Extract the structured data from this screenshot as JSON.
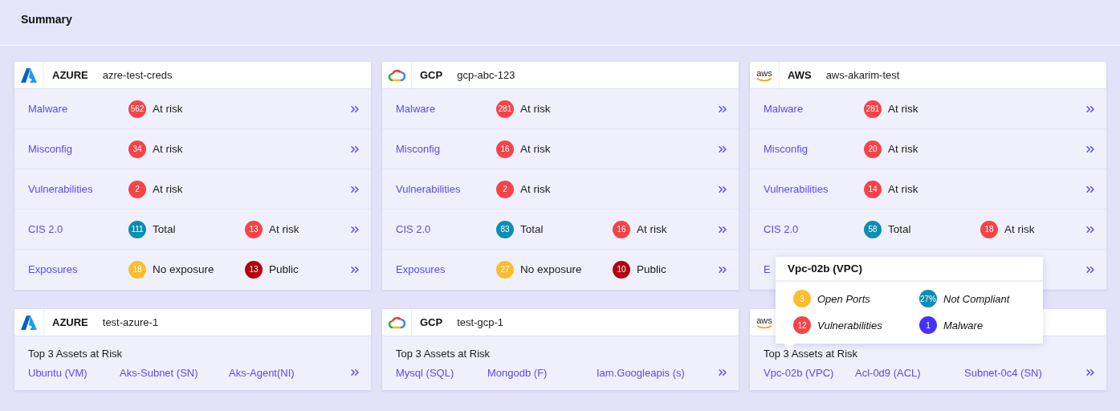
{
  "header": {
    "title": "Summary"
  },
  "accounts": [
    {
      "logo": {
        "kind": "azure"
      },
      "provider": "AZURE",
      "account": "azre-test-creds",
      "rows": [
        {
          "label": "Malware",
          "metrics": [
            {
              "count": "562",
              "label": "At risk",
              "color": "#f54448"
            }
          ]
        },
        {
          "label": "Misconfig",
          "metrics": [
            {
              "count": "34",
              "label": "At risk",
              "color": "#f54448"
            }
          ]
        },
        {
          "label": "Vulnerabilities",
          "metrics": [
            {
              "count": "2",
              "label": "At risk",
              "color": "#f54448"
            }
          ]
        },
        {
          "label": "CIS 2.0",
          "metrics": [
            {
              "count": "111",
              "label": "Total",
              "color": "#0c8db3"
            },
            {
              "count": "13",
              "label": "At risk",
              "color": "#f54448"
            }
          ]
        },
        {
          "label": "Exposures",
          "metrics": [
            {
              "count": "18",
              "label": "No exposure",
              "color": "#fbbd2e"
            },
            {
              "count": "13",
              "label": "Public",
              "color": "#b3000f"
            }
          ]
        }
      ]
    },
    {
      "logo": {
        "kind": "gcp"
      },
      "provider": "GCP",
      "account": "gcp-abc-123",
      "rows": [
        {
          "label": "Malware",
          "metrics": [
            {
              "count": "281",
              "label": "At risk",
              "color": "#f54448"
            }
          ]
        },
        {
          "label": "Misconfig",
          "metrics": [
            {
              "count": "16",
              "label": "At risk",
              "color": "#f54448"
            }
          ]
        },
        {
          "label": "Vulnerabilities",
          "metrics": [
            {
              "count": "2",
              "label": "At risk",
              "color": "#f54448"
            }
          ]
        },
        {
          "label": "CIS 2.0",
          "metrics": [
            {
              "count": "83",
              "label": "Total",
              "color": "#0c8db3"
            },
            {
              "count": "16",
              "label": "At risk",
              "color": "#f54448"
            }
          ]
        },
        {
          "label": "Exposures",
          "metrics": [
            {
              "count": "27",
              "label": "No exposure",
              "color": "#fbbd2e"
            },
            {
              "count": "10",
              "label": "Public",
              "color": "#b3000f"
            }
          ]
        }
      ]
    },
    {
      "logo": {
        "kind": "aws",
        "text": "aws"
      },
      "provider": "AWS",
      "account": "aws-akarim-test",
      "rows": [
        {
          "label": "Malware",
          "metrics": [
            {
              "count": "281",
              "label": "At risk",
              "color": "#f54448"
            }
          ]
        },
        {
          "label": "Misconfig",
          "metrics": [
            {
              "count": "20",
              "label": "At risk",
              "color": "#f54448"
            }
          ]
        },
        {
          "label": "Vulnerabilities",
          "metrics": [
            {
              "count": "14",
              "label": "At risk",
              "color": "#f54448"
            }
          ]
        },
        {
          "label": "CIS 2.0",
          "metrics": [
            {
              "count": "58",
              "label": "Total",
              "color": "#0c8db3"
            },
            {
              "count": "18",
              "label": "At risk",
              "color": "#f54448"
            }
          ]
        },
        {
          "label": "E",
          "metrics": []
        }
      ],
      "tooltip": {
        "title": "Vpc-02b (VPC)",
        "items": [
          {
            "count": "3",
            "label": "Open Ports",
            "color": "#fbbd2e"
          },
          {
            "count": "27%",
            "label": "Not Compliant",
            "color": "#0c8db3"
          },
          {
            "count": "12",
            "label": "Vulnerabilities",
            "color": "#f54448"
          },
          {
            "count": "1",
            "label": "Malware",
            "color": "#4433ff"
          }
        ]
      }
    }
  ],
  "assets": [
    {
      "logo": {
        "kind": "azure"
      },
      "provider": "AZURE",
      "account": "test-azure-1",
      "heading": "Top 3 Assets at Risk",
      "links": [
        "Ubuntu (VM)",
        "Aks-Subnet (SN)",
        "Aks-Agent(NI)"
      ]
    },
    {
      "logo": {
        "kind": "gcp"
      },
      "provider": "GCP",
      "account": "test-gcp-1",
      "heading": "Top 3 Assets at Risk",
      "links": [
        "Mysql (SQL)",
        "Mongodb (F)",
        "Iam.Googleapis (s)"
      ]
    },
    {
      "logo": {
        "kind": "aws",
        "text": "aws"
      },
      "heading": "Top 3 Assets at Risk",
      "links": [
        "Vpc-02b (VPC)",
        "Acl-0d9 (ACL)",
        "Subnet-0c4 (SN)"
      ]
    }
  ]
}
